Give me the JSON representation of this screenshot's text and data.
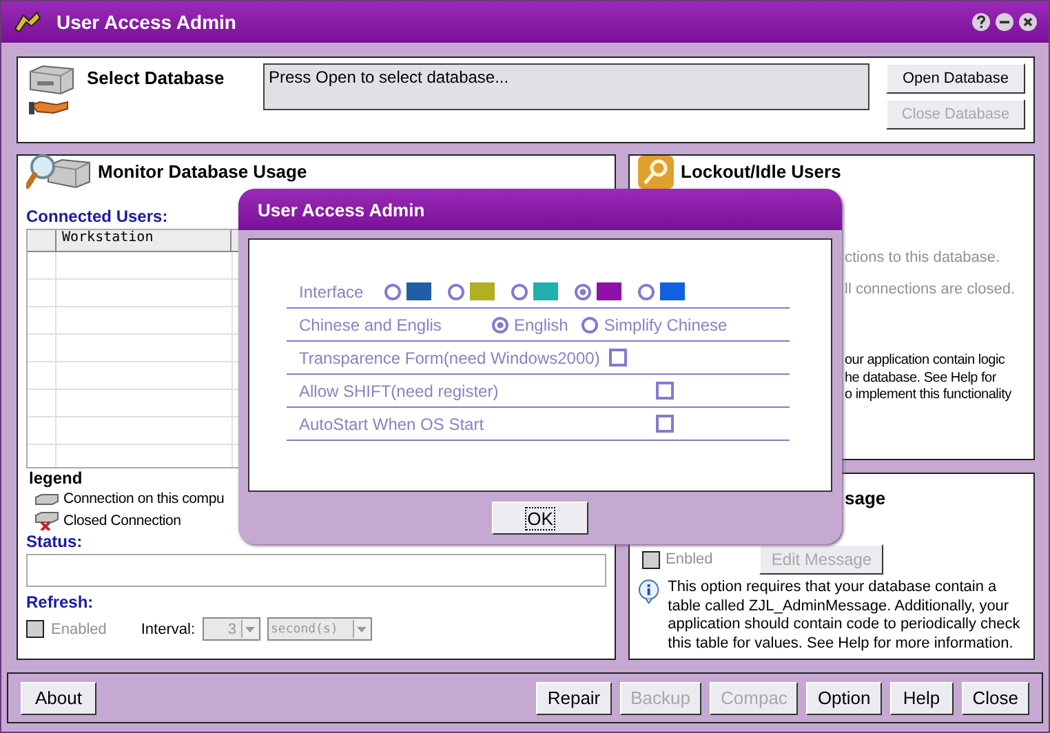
{
  "window": {
    "title": "User Access Admin"
  },
  "select_database": {
    "title": "Select Database",
    "path_text": "Press Open to select database...",
    "buttons": [
      {
        "label": "Open Database",
        "disabled": false
      },
      {
        "label": "Close Database",
        "disabled": true
      }
    ]
  },
  "monitor": {
    "title": "Monitor Database Usage",
    "connected_label": "Connected Users:",
    "columns": [
      "Workstation"
    ],
    "legend_title": "legend",
    "legend": [
      {
        "kind": "open",
        "label": "Connection on this compu"
      },
      {
        "kind": "closed",
        "label": "Closed Connection"
      }
    ],
    "status_label": "Status:",
    "refresh_label": "Refresh:",
    "refresh_enabled": {
      "label": "Enabled",
      "checked": false,
      "disabled": true
    },
    "interval_label": "Interval:",
    "interval_value": "3",
    "interval_unit": "second(s)"
  },
  "lockout": {
    "title": "Lockout/Idle Users",
    "lines": [
      "ctions to this database.",
      "ll connections are closed."
    ],
    "note_lines": [
      "our application contain logic",
      "he database. See Help for",
      "o implement this functionality"
    ]
  },
  "message": {
    "title": "sage",
    "enabled": {
      "label": "Enbled",
      "checked": false,
      "disabled": true
    },
    "edit_button": {
      "label": "Edit Message",
      "disabled": true
    },
    "info": "This option requires that your database contain a table called ZJL_AdminMessage. Additionally, your application should contain code to periodically check this table for values. See Help for more information."
  },
  "footer_buttons": [
    {
      "label": "About",
      "disabled": false
    },
    {
      "label": "Repair",
      "disabled": false
    },
    {
      "label": "Backup",
      "disabled": true
    },
    {
      "label": "Compac",
      "disabled": true
    },
    {
      "label": "Option",
      "disabled": false
    },
    {
      "label": "Help",
      "disabled": false
    },
    {
      "label": "Close",
      "disabled": false
    }
  ],
  "dialog": {
    "title": "User Access Admin",
    "rows": [
      {
        "kind": "colors",
        "label": "Interface",
        "options": [
          {
            "color": "#1e5fa8",
            "selected": false
          },
          {
            "color": "#b0b020",
            "selected": false
          },
          {
            "color": "#20b0b0",
            "selected": false
          },
          {
            "color": "#9010a8",
            "selected": true
          },
          {
            "color": "#1060e0",
            "selected": false
          }
        ]
      },
      {
        "kind": "radios",
        "label": "Chinese and Englis",
        "options": [
          {
            "label": "English",
            "selected": true
          },
          {
            "label": "Simplify Chinese",
            "selected": false
          }
        ]
      },
      {
        "kind": "checkbox",
        "label": "Transparence Form(need Windows2000)",
        "checked": false
      },
      {
        "kind": "checkbox",
        "label": "Allow SHIFT(need register)",
        "checked": false
      },
      {
        "kind": "checkbox",
        "label": "AutoStart When OS Start",
        "checked": false
      }
    ],
    "ok": "OK"
  }
}
